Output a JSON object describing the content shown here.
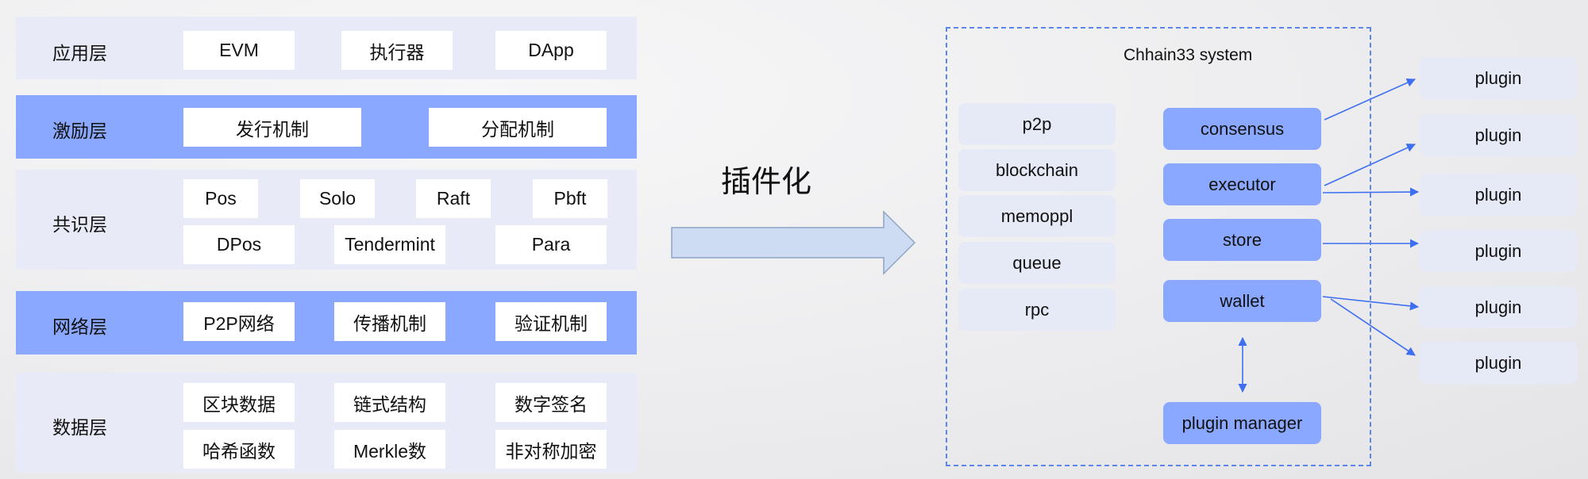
{
  "layers": {
    "application": {
      "label": "应用层",
      "items": [
        "EVM",
        "执行器",
        "DApp"
      ]
    },
    "incentive": {
      "label": "激励层",
      "items": [
        "发行机制",
        "分配机制"
      ]
    },
    "consensus": {
      "label": "共识层",
      "row1": [
        "Pos",
        "Solo",
        "Raft",
        "Pbft"
      ],
      "row2": [
        "DPos",
        "Tendermint",
        "Para"
      ]
    },
    "network": {
      "label": "网络层",
      "items": [
        "P2P网络",
        "传播机制",
        "验证机制"
      ]
    },
    "data": {
      "label": "数据层",
      "row1": [
        "区块数据",
        "链式结构",
        "数字签名"
      ],
      "row2": [
        "哈希函数",
        "Merkle数",
        "非对称加密"
      ]
    }
  },
  "transition": {
    "label": "插件化",
    "arrow_color": "#cddcf2"
  },
  "system": {
    "title": "Chhain33 system",
    "core_modules": [
      "p2p",
      "blockchain",
      "memoppl",
      "queue",
      "rpc"
    ],
    "pluggable_modules": [
      "consensus",
      "executor",
      "store",
      "wallet"
    ],
    "manager": "plugin manager",
    "plugins": [
      "plugin",
      "plugin",
      "plugin",
      "plugin",
      "plugin",
      "plugin"
    ]
  },
  "colors": {
    "accent": "#8aa8ff",
    "light_band": "#e8ebf7",
    "connector": "#3d6ff0",
    "dashed_border": "#5b86f0"
  }
}
